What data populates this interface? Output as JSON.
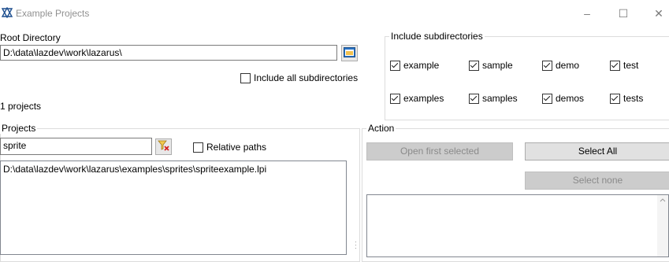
{
  "window": {
    "title": "Example Projects",
    "controls": {
      "minimize": "–",
      "maximize": "☐",
      "close": "✕"
    }
  },
  "root_directory": {
    "label": "Root Directory",
    "value": "D:\\data\\lazdev\\work\\lazarus\\",
    "browse_icon": "folder-icon"
  },
  "include_all": {
    "label": "Include all subdirectories",
    "checked": false
  },
  "projects_count": "1 projects",
  "include_subdirs": {
    "title": "Include subdirectories",
    "items": [
      {
        "label": "example",
        "checked": true
      },
      {
        "label": "sample",
        "checked": true
      },
      {
        "label": "demo",
        "checked": true
      },
      {
        "label": "test",
        "checked": true
      },
      {
        "label": "examples",
        "checked": true
      },
      {
        "label": "samples",
        "checked": true
      },
      {
        "label": "demos",
        "checked": true
      },
      {
        "label": "tests",
        "checked": true
      }
    ]
  },
  "projects": {
    "title": "Projects",
    "filter_value": "sprite",
    "clear_filter_icon": "clear-filter-icon",
    "relative_paths": {
      "label": "Relative paths",
      "checked": false
    },
    "list": [
      "D:\\data\\lazdev\\work\\lazarus\\examples\\sprites\\spriteexample.lpi"
    ]
  },
  "action": {
    "title": "Action",
    "open_first": "Open first selected",
    "select_all": "Select All",
    "select_none": "Select none"
  },
  "colors": {
    "accent": "#1e6fbf",
    "disabled_button": "#cccccc",
    "button": "#e1e1e1"
  }
}
